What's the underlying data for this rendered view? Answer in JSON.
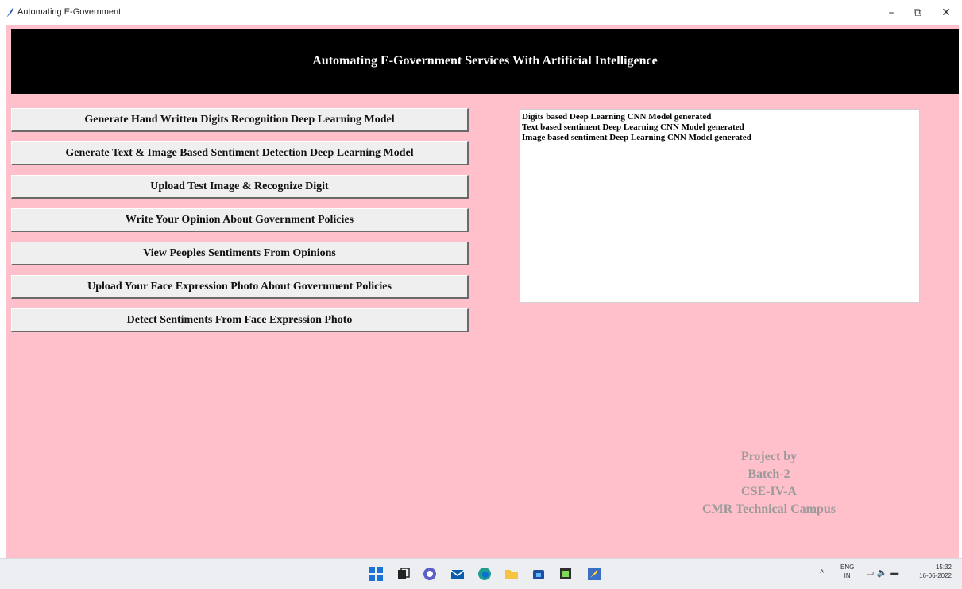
{
  "window": {
    "title": "Automating E-Government",
    "minimize_glyph": "–",
    "maximize_glyph": "⧉",
    "close_glyph": "✕"
  },
  "app": {
    "banner_title": "Automating E-Government Services With Artificial Intelligence",
    "buttons": [
      "Generate Hand Written Digits Recognition Deep Learning Model",
      "Generate Text & Image Based Sentiment Detection Deep Learning Model",
      "Upload Test Image & Recognize Digit",
      "Write Your Opinion About Government Policies",
      "View Peoples Sentiments From Opinions",
      "Upload Your Face Expression Photo About Government Policies",
      "Detect Sentiments From Face Expression Photo"
    ],
    "output_lines": [
      "Digits based Deep Learning CNN Model generated",
      "Text based sentiment Deep Learning CNN Model generated",
      "Image based sentiment Deep Learning CNN Model generated"
    ],
    "credits": [
      "Project by",
      "Batch-2",
      "CSE-IV-A",
      "CMR Technical Campus"
    ]
  },
  "taskbar": {
    "icons": [
      "windows-start-icon",
      "task-view-icon",
      "chat-icon",
      "mail-icon",
      "edge-browser-icon",
      "file-explorer-icon",
      "store-icon",
      "python-app-icon",
      "feather-app-icon"
    ],
    "tray": {
      "chevron": "^",
      "lang_top": "ENG",
      "lang_bottom": "IN",
      "time": "15:32",
      "date": "16-06-2022"
    }
  },
  "colors": {
    "client_bg": "#ffc0cb",
    "banner_bg": "#000000",
    "credits_text": "#9a9a9a"
  }
}
